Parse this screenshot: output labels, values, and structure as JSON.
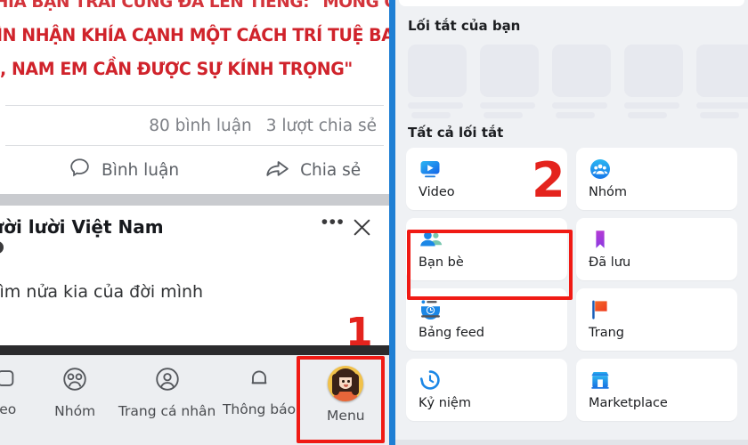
{
  "left_panel": {
    "post": {
      "headline_lines": [
        "HIA BẠN TRAI CŨNG ĐÃ LÊN TIẾNG: \"MONG CÁC",
        "ÌN NHẬN KHÍA CẠNH MỘT CÁCH TRÍ TUỆ BAO",
        ", NAM EM CẦN ĐƯỢC SỰ KÍNH TRỌNG\""
      ],
      "comment_count": "80 bình luận",
      "share_count": "3 lượt chia sẻ",
      "comment_button": "Bình luận",
      "share_button": "Chia sẻ",
      "comment_icon": "speech-bubble-icon",
      "share_icon": "share-arrow-icon"
    },
    "card2": {
      "title": "ười lười Việt Nam",
      "body": "tìm nửa kia của đời mình",
      "more_icon": "ellipsis-icon",
      "close_icon": "close-x-icon"
    },
    "bottom_nav": [
      {
        "label": "eo",
        "icon": "video-icon"
      },
      {
        "label": "Nhóm",
        "icon": "groups-icon"
      },
      {
        "label": "Trang cá nhân",
        "icon": "profile-icon"
      },
      {
        "label": "Thông báo",
        "icon": "bell-icon"
      },
      {
        "label": "Menu",
        "icon": "avatar-icon"
      }
    ],
    "marker_1": "1"
  },
  "right_panel": {
    "section_shortcuts_title": "Lối tắt của bạn",
    "section_all_title": "Tất cả lối tắt",
    "skeleton_count": 5,
    "tiles": [
      {
        "label": "Video",
        "icon": "video-play-icon"
      },
      {
        "label": "Nhóm",
        "icon": "groups-circle-icon"
      },
      {
        "label": "Bạn bè",
        "icon": "friends-icon"
      },
      {
        "label": "Đã lưu",
        "icon": "bookmark-icon"
      },
      {
        "label": "Bảng feed",
        "icon": "news-feed-icon"
      },
      {
        "label": "Trang",
        "icon": "flag-icon"
      },
      {
        "label": "Kỷ niệm",
        "icon": "memories-clock-icon"
      },
      {
        "label": "Marketplace",
        "icon": "marketplace-store-icon"
      }
    ],
    "marker_2": "2"
  },
  "colors": {
    "headline_red": "#d0232b",
    "marker_red": "#e4231d",
    "highlight_box_red": "#f01a14",
    "divider_blue": "#1f7fd4",
    "facebook_blue": "#1877f2",
    "bookmark_purple": "#a033d0",
    "flag_orange": "#f3551f",
    "panel_bg": "#eff1f4"
  }
}
